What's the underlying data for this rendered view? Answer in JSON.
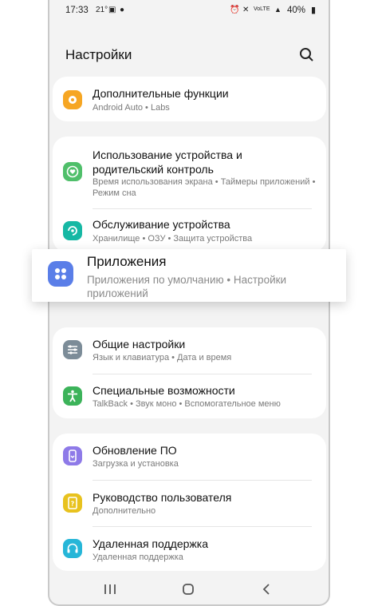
{
  "status_bar": {
    "time": "17:33",
    "temp": "21°",
    "battery": "40%"
  },
  "header": {
    "title": "Настройки",
    "search_icon": "search-icon"
  },
  "colors": {
    "orange": "#f6a623",
    "green": "#4fbf6a",
    "teal": "#16b8a4",
    "blue": "#5a7ee8",
    "gray": "#7c8c98",
    "green2": "#3cb35a",
    "purple": "#8e7ae8",
    "yellow": "#e8c21e",
    "cyan": "#26b6d8"
  },
  "groups": [
    {
      "items": [
        {
          "title": "Дополнительные функции",
          "subtitle": "Android Auto  •  Labs",
          "icon": "plus-gear-icon"
        }
      ]
    },
    {
      "items": [
        {
          "title": "Использование устройства и родительский контроль",
          "subtitle": "Время использования экрана  •  Таймеры приложений  •  Режим сна",
          "icon": "heart-circle-icon"
        },
        {
          "title": "Обслуживание устройства",
          "subtitle": "Хранилище  •  ОЗУ  •  Защита устройства",
          "icon": "device-care-icon"
        }
      ]
    },
    {
      "items": [
        {
          "title": "Общие настройки",
          "subtitle": "Язык и клавиатура  •  Дата и время",
          "icon": "sliders-icon"
        },
        {
          "title": "Специальные возможности",
          "subtitle": "TalkBack  •  Звук моно  •  Вспомогательное меню",
          "icon": "accessibility-icon"
        }
      ]
    },
    {
      "items": [
        {
          "title": "Обновление ПО",
          "subtitle": "Загрузка и установка",
          "icon": "update-icon"
        },
        {
          "title": "Руководство пользователя",
          "subtitle": "Дополнительно",
          "icon": "manual-icon"
        },
        {
          "title": "Удаленная поддержка",
          "subtitle": "Удаленная поддержка",
          "icon": "headset-icon"
        }
      ]
    }
  ],
  "highlight": {
    "title": "Приложения",
    "subtitle": "Приложения по умолчанию  •  Настройки приложений",
    "icon": "apps-icon"
  },
  "navbar": {
    "recents": "recents-icon",
    "home": "home-icon",
    "back": "back-icon"
  }
}
